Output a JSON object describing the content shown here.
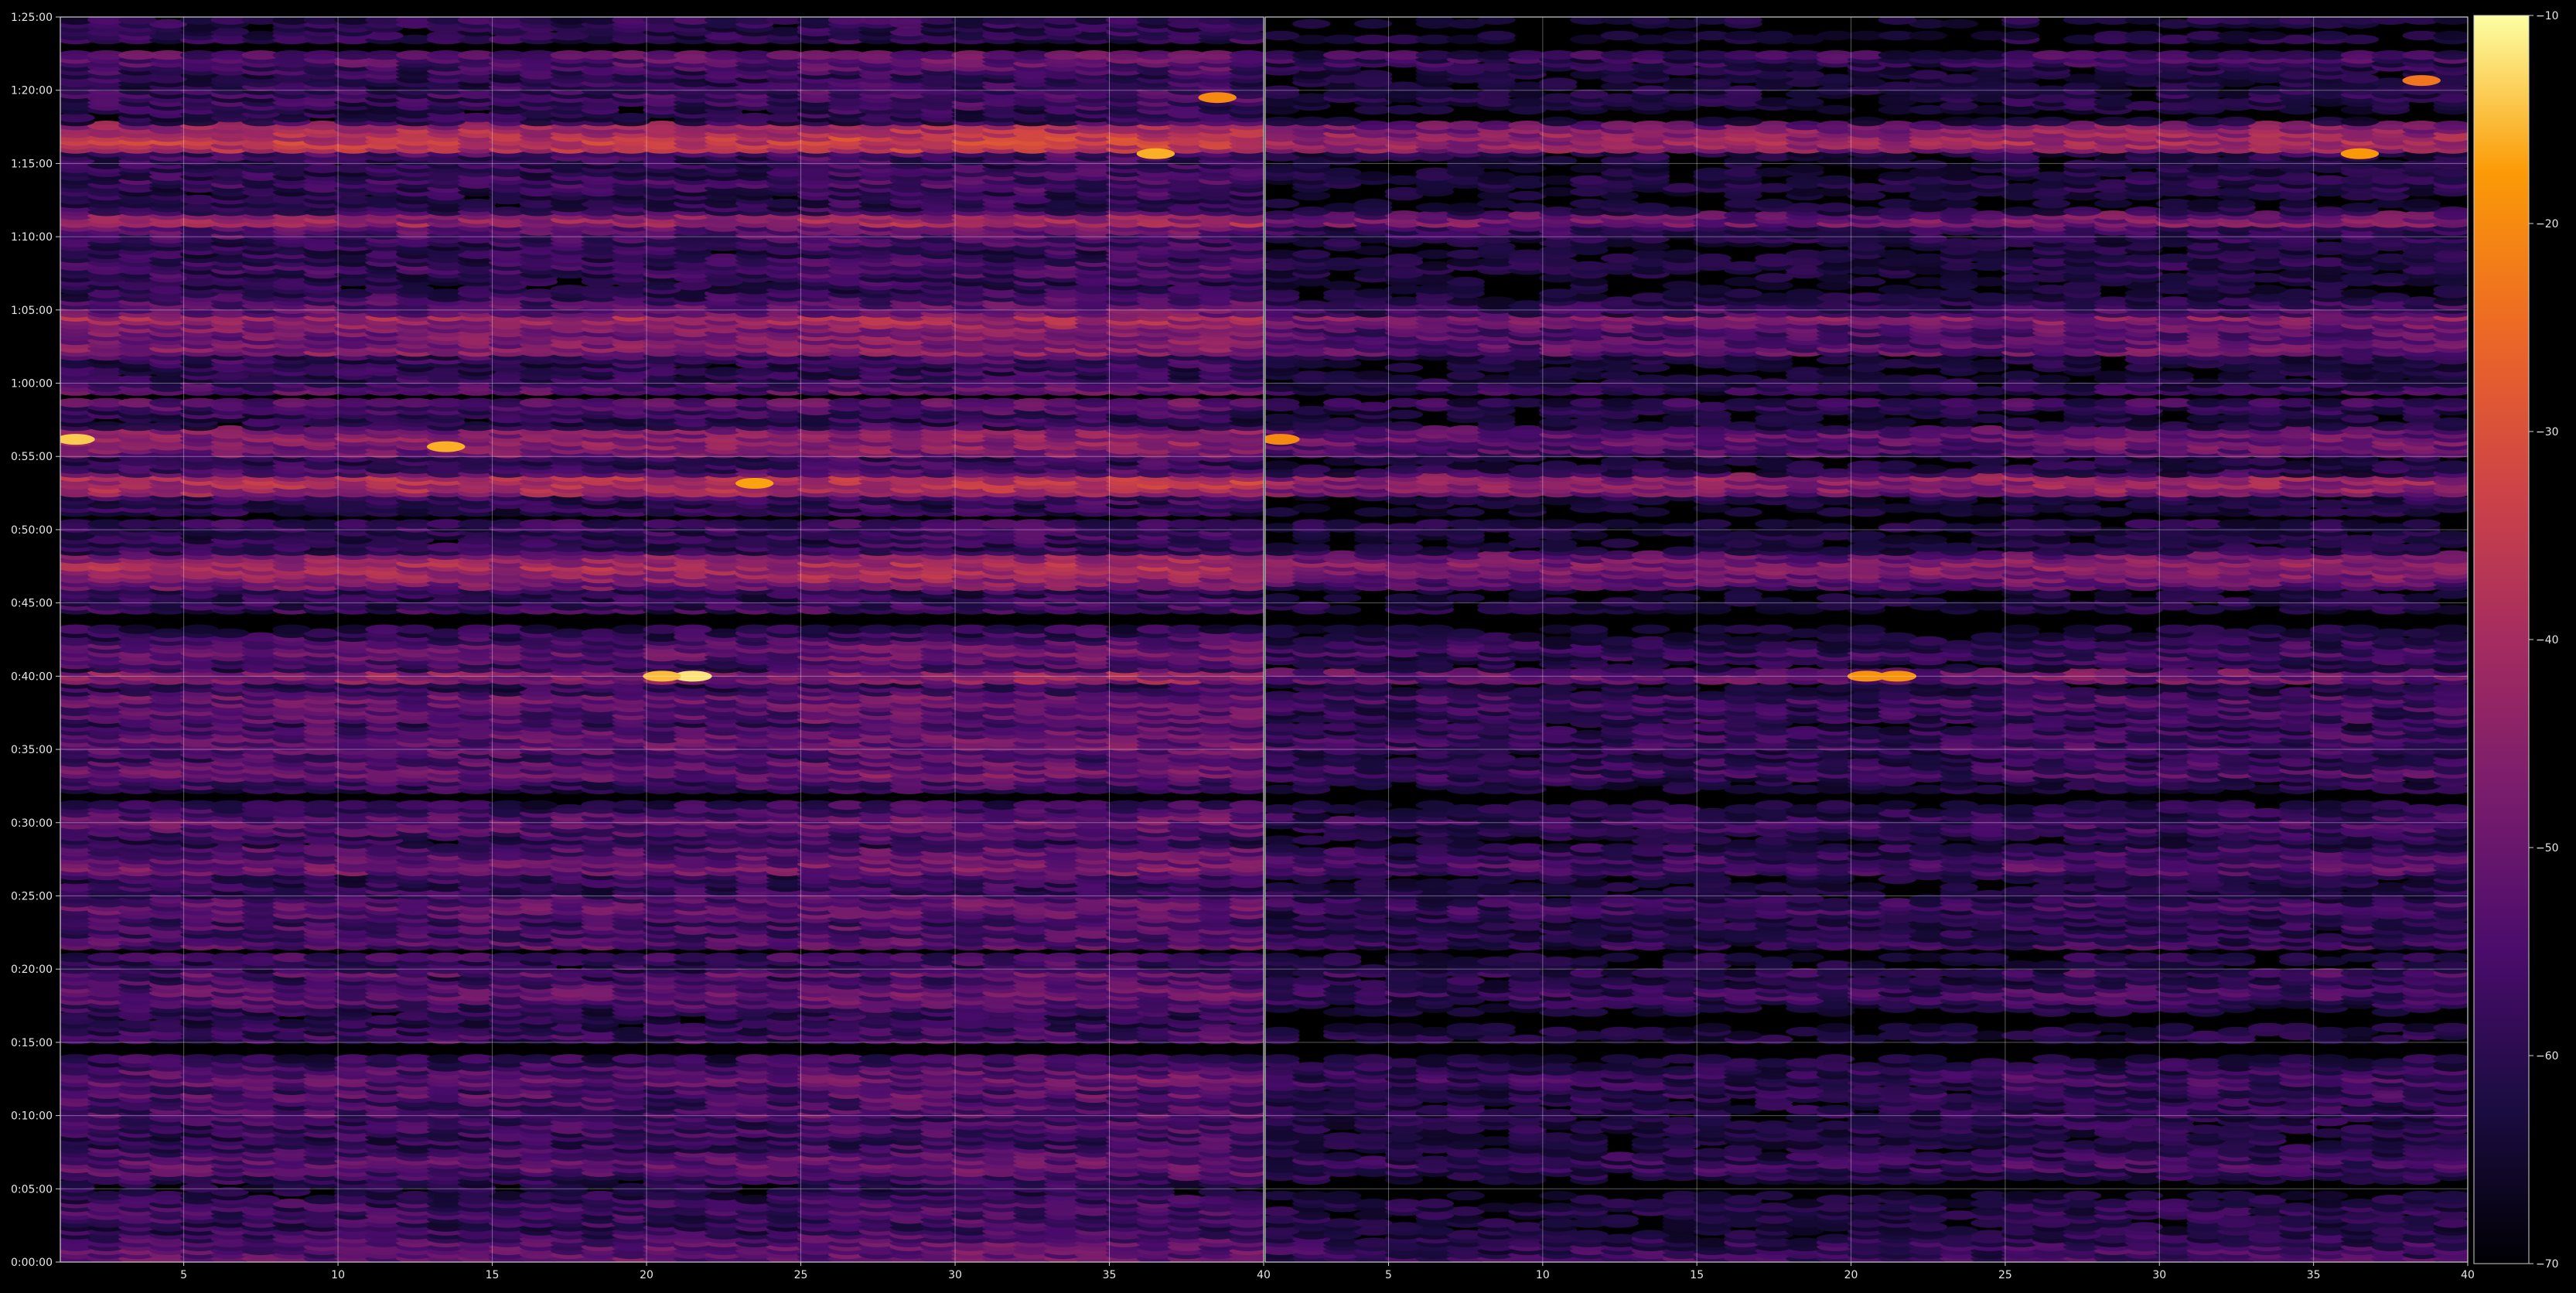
{
  "chart_data": {
    "type": "heatmap",
    "title": "",
    "xlabel": "",
    "ylabel": "",
    "grid": true,
    "background": "#000000",
    "colormap": "inferno",
    "color_range": [
      -70,
      -10
    ],
    "colorbar": {
      "placement": "right",
      "ticks": [
        -10,
        -20,
        -30,
        -40,
        -50,
        -60,
        -70
      ],
      "tick_labels": [
        "−10",
        "−20",
        "−30",
        "−40",
        "−50",
        "−60",
        "−70"
      ]
    },
    "y_axis": {
      "range_seconds": [
        0,
        5100
      ],
      "tick_values_seconds": [
        0,
        300,
        600,
        900,
        1200,
        1500,
        1800,
        2100,
        2400,
        2700,
        3000,
        3300,
        3600,
        3900,
        4200,
        4500,
        4800,
        5100
      ],
      "tick_labels": [
        "0:00:00",
        "0:05:00",
        "0:10:00",
        "0:15:00",
        "0:20:00",
        "0:25:00",
        "0:30:00",
        "0:35:00",
        "0:40:00",
        "0:45:00",
        "0:50:00",
        "0:55:00",
        "1:00:00",
        "1:05:00",
        "1:10:00",
        "1:15:00",
        "1:20:00",
        "1:25:00"
      ]
    },
    "panels": [
      {
        "x_range": [
          1,
          40
        ],
        "x_ticks": [
          5,
          10,
          15,
          20,
          25,
          30,
          35,
          40
        ],
        "x_tick_labels": [
          "5",
          "10",
          "15",
          "20",
          "25",
          "30",
          "35",
          "40"
        ],
        "hotspots": [
          {
            "x": 21.5,
            "y": 2400,
            "value": -12
          },
          {
            "x": 20.5,
            "y": 2400,
            "value": -15
          },
          {
            "x": 1.5,
            "y": 3370,
            "value": -14
          },
          {
            "x": 13.5,
            "y": 3340,
            "value": -16
          },
          {
            "x": 23.5,
            "y": 3190,
            "value": -17
          },
          {
            "x": 36.5,
            "y": 4540,
            "value": -16
          },
          {
            "x": 38.5,
            "y": 4770,
            "value": -20
          }
        ]
      },
      {
        "x_range": [
          1,
          40
        ],
        "x_ticks": [
          5,
          10,
          15,
          20,
          25,
          30,
          35,
          40
        ],
        "x_tick_labels": [
          "5",
          "10",
          "15",
          "20",
          "25",
          "30",
          "35",
          "40"
        ],
        "hotspots": [
          {
            "x": 20.5,
            "y": 2400,
            "value": -19
          },
          {
            "x": 21.5,
            "y": 2400,
            "value": -19
          },
          {
            "x": 1.5,
            "y": 3370,
            "value": -20
          },
          {
            "x": 36.5,
            "y": 4540,
            "value": -18
          },
          {
            "x": 38.5,
            "y": 4840,
            "value": -23
          }
        ]
      }
    ]
  }
}
